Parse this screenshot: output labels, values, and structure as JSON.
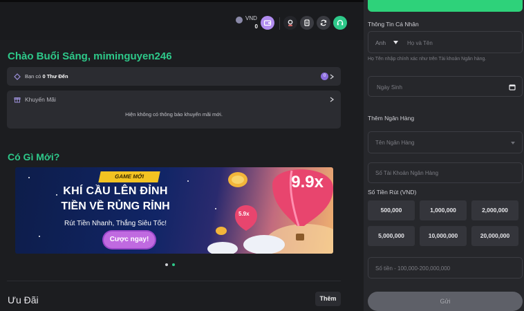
{
  "header": {
    "currency": "VND",
    "balance": "0",
    "icons": [
      "wallet-icon",
      "avatar-icon",
      "clipboard-icon",
      "refresh-icon",
      "headset-icon"
    ]
  },
  "greeting": "Chào Buổi Sáng, miminguyen246",
  "mail": {
    "prefix": "Bạn có",
    "strong": "0 Thư Đến",
    "badge": "0"
  },
  "promo": {
    "label": "Khuyến Mãi",
    "empty": "Hiện không có thông báo khuyến mãi mới."
  },
  "whats_new": "Có Gì Mới?",
  "banner": {
    "tag": "GAME MỚI",
    "line1": "KHÍ CẦU LÊN ĐỈNH",
    "line2": "TIỀN VỀ RỦNG RỈNH",
    "subtitle": "Rút Tiền Nhanh, Thắng Siêu Tốc!",
    "cta": "Cược ngay!",
    "mult_big": "9.9x",
    "mult_small": "5.9x"
  },
  "offers": {
    "title": "Ưu Đãi",
    "more": "Thêm"
  },
  "withdraw": {
    "personal_title": "Thông Tin Cá Nhân",
    "title_select": "Anh",
    "name_placeholder": "Họ và Tên",
    "name_hint": "Họ Tên nhập chính xác như trên Tài khoản Ngân hàng.",
    "dob_placeholder": "Ngày Sinh",
    "bank_title": "Thêm Ngân Hàng",
    "bank_name_placeholder": "Tên Ngân Hàng",
    "account_placeholder": "Số Tài Khoản Ngân Hàng",
    "amount_title": "Số Tiền Rút (VND)",
    "amounts": [
      "500,000",
      "1,000,000",
      "2,000,000",
      "5,000,000",
      "10,000,000",
      "20,000,000"
    ],
    "amount_placeholder": "Số tiền - 100,000-200,000,000",
    "submit": "Gửi"
  },
  "colors": {
    "accent": "#2ec98a",
    "brand_green": "#2ed27a",
    "purple": "#8b6dde"
  }
}
